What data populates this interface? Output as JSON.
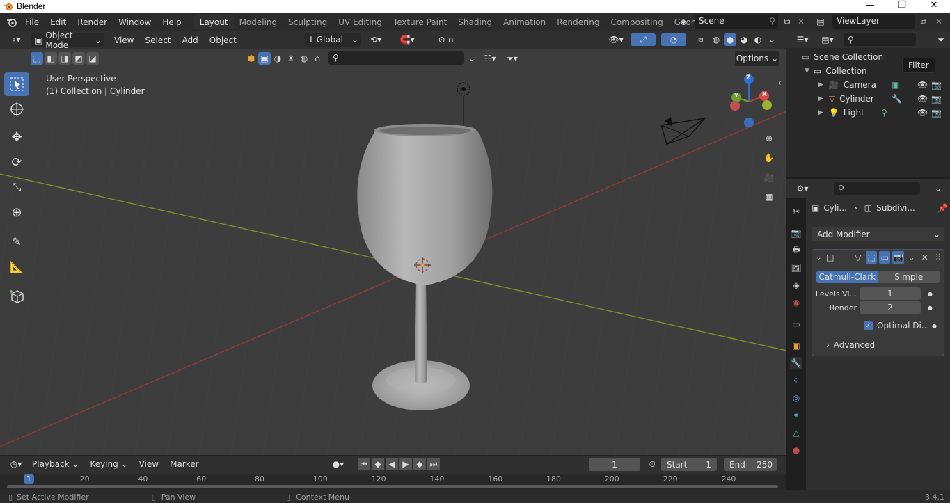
{
  "window": {
    "title": "Blender",
    "minimize": "—",
    "maximize": "❐",
    "close": "✕"
  },
  "menu": [
    "File",
    "Edit",
    "Render",
    "Window",
    "Help"
  ],
  "workspaces": [
    "Layout",
    "Modeling",
    "Sculpting",
    "UV Editing",
    "Texture Paint",
    "Shading",
    "Animation",
    "Rendering",
    "Compositing",
    "Geometry Node"
  ],
  "active_workspace": "Layout",
  "scene": {
    "name": "Scene",
    "view_layer": "ViewLayer"
  },
  "viewport_header": {
    "mode": "Object Mode",
    "menus": [
      "View",
      "Select",
      "Add",
      "Object"
    ],
    "orientation": "Global",
    "options": "Options"
  },
  "viewport": {
    "perspective": "User Perspective",
    "collection_info": "(1) Collection | Cylinder",
    "gizmo": {
      "z": "Z",
      "y": "Y",
      "x": "X"
    }
  },
  "outliner": {
    "root": "Scene Collection",
    "collection": "Collection",
    "items": [
      {
        "label": "Camera",
        "icon": "camera-icon"
      },
      {
        "label": "Cylinder",
        "icon": "mesh-icon"
      },
      {
        "label": "Light",
        "icon": "light-icon"
      }
    ],
    "tooltip": "Filter"
  },
  "properties": {
    "breadcrumb_object": "Cyli...",
    "breadcrumb_modifier": "Subdivi...",
    "add_modifier": "Add Modifier",
    "modifier": {
      "catmull": "Catmull-Clark",
      "simple": "Simple",
      "levels_label": "Levels Vi...",
      "levels_value": "1",
      "render_label": "Render",
      "render_value": "2",
      "optimal": "Optimal Di...",
      "advanced": "Advanced"
    }
  },
  "timeline": {
    "menus": [
      "Playback",
      "Keying",
      "View",
      "Marker"
    ],
    "current_frame": "1",
    "start_label": "Start",
    "start": "1",
    "end_label": "End",
    "end": "250",
    "ruler": [
      "1",
      "20",
      "40",
      "60",
      "80",
      "100",
      "120",
      "140",
      "160",
      "180",
      "200",
      "220",
      "240"
    ]
  },
  "statusbar": {
    "left": "Set Active Modifier",
    "middle": "Pan View",
    "right": "Context Menu",
    "version": "3.4.1"
  }
}
